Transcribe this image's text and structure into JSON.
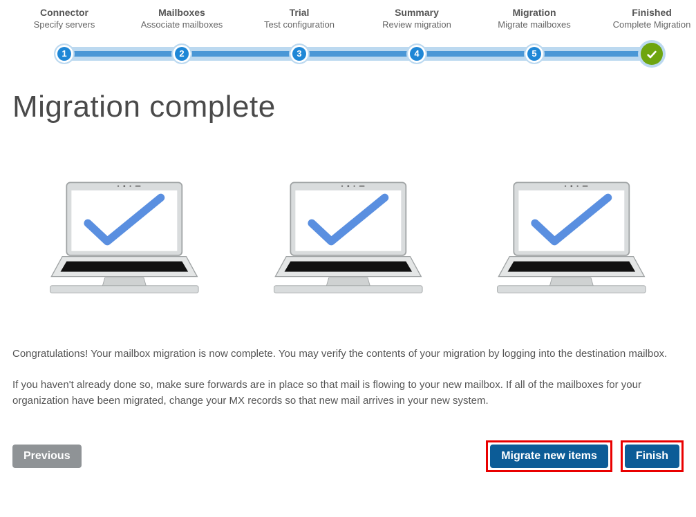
{
  "stepper": {
    "steps": [
      {
        "title": "Connector",
        "sub": "Specify servers",
        "node": "1"
      },
      {
        "title": "Mailboxes",
        "sub": "Associate mailboxes",
        "node": "2"
      },
      {
        "title": "Trial",
        "sub": "Test configuration",
        "node": "3"
      },
      {
        "title": "Summary",
        "sub": "Review migration",
        "node": "4"
      },
      {
        "title": "Migration",
        "sub": "Migrate mailboxes",
        "node": "5"
      },
      {
        "title": "Finished",
        "sub": "Complete Migration",
        "node": "done"
      }
    ]
  },
  "page_title": "Migration complete",
  "paragraph1": "Congratulations! Your mailbox migration is now complete. You may verify the contents of your migration by logging into the destination mailbox.",
  "paragraph2": "If you haven't already done so, make sure forwards are in place so that mail is flowing to your new mailbox. If all of the mailboxes for your organization have been migrated, change your MX records so that new mail arrives in your new system.",
  "buttons": {
    "previous": "Previous",
    "migrate_new_items": "Migrate new items",
    "finish": "Finish"
  }
}
